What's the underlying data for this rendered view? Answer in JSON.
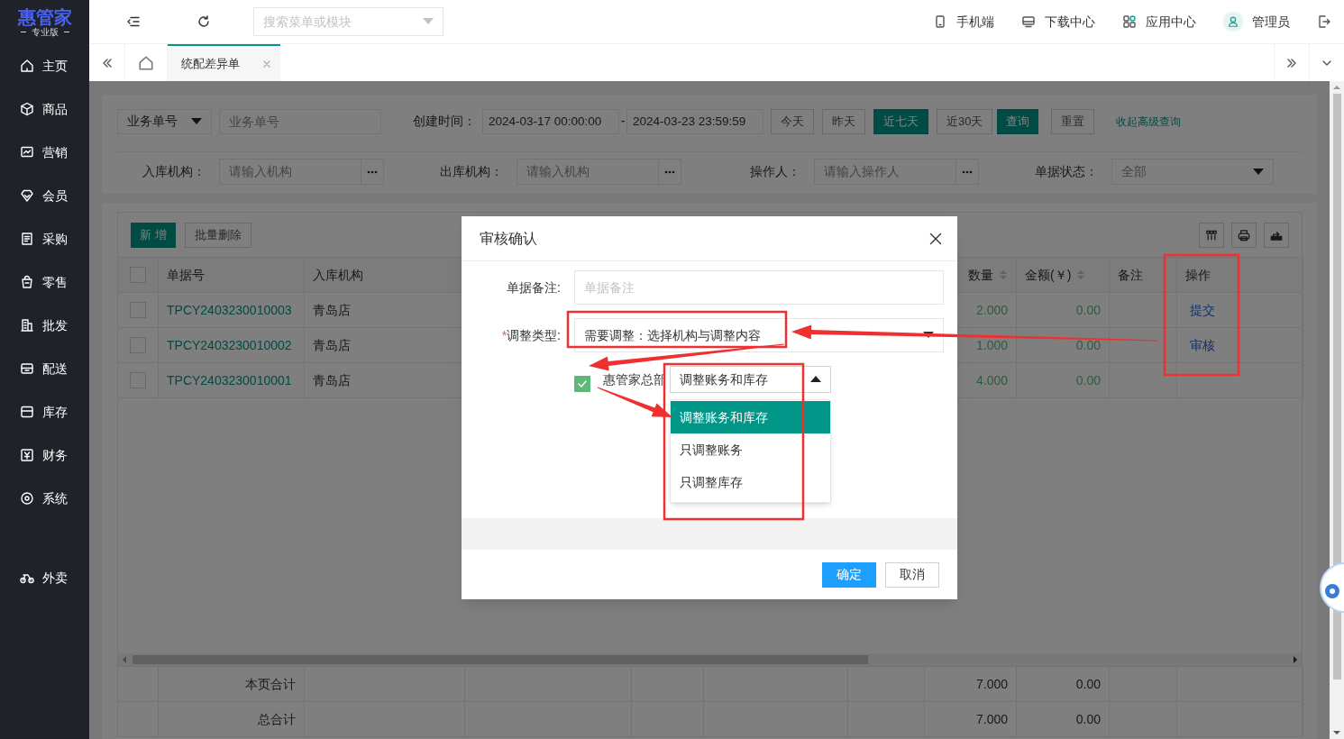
{
  "sidebar": {
    "logo": "惠管家",
    "edition": "专业版",
    "items": [
      {
        "label": "主页",
        "kind": "home"
      },
      {
        "label": "商品",
        "kind": "box"
      },
      {
        "label": "营销",
        "kind": "chart"
      },
      {
        "label": "会员",
        "kind": "gem"
      },
      {
        "label": "采购",
        "kind": "list"
      },
      {
        "label": "零售",
        "kind": "bag"
      },
      {
        "label": "批发",
        "kind": "building"
      },
      {
        "label": "配送",
        "kind": "crate"
      },
      {
        "label": "库存",
        "kind": "tray"
      },
      {
        "label": "财务",
        "kind": "money"
      },
      {
        "label": "系统",
        "kind": "target"
      }
    ],
    "bottom_items": [
      {
        "label": "外卖",
        "kind": "bike"
      }
    ]
  },
  "top_bar": {
    "search": {
      "placeholder": "搜索菜单或模块"
    },
    "links": [
      {
        "label": "手机端",
        "kind": "phone"
      },
      {
        "label": "下载中心",
        "kind": "monitor"
      },
      {
        "label": "应用中心",
        "kind": "apps"
      },
      {
        "label": "管理员",
        "kind": "user"
      }
    ]
  },
  "tabs": [
    {
      "label": "统配差异单",
      "selected": true
    }
  ],
  "filters": {
    "type_select": "业务单号",
    "number_placeholder": "业务单号",
    "created_label": "创建时间：",
    "date_from": "2024-03-17 00:00:00",
    "date_sep": "-",
    "date_to": "2024-03-23 23:59:59",
    "ranges": [
      {
        "label": "今天",
        "selected": false
      },
      {
        "label": "昨天",
        "selected": false
      },
      {
        "label": "近七天",
        "selected": true
      },
      {
        "label": "近30天",
        "selected": false
      }
    ],
    "query": "查询",
    "reset": "重置",
    "collapse": "收起高级查询",
    "fields": [
      {
        "label": "入库机构：",
        "placeholder": "请输入机构"
      },
      {
        "label": "出库机构：",
        "placeholder": "请输入机构"
      },
      {
        "label": "操作人：",
        "placeholder": "请输入操作人"
      }
    ],
    "status": {
      "label": "单据状态：",
      "placeholder": "全部"
    }
  },
  "toolbar": {
    "buttons": [
      {
        "label": "新 增",
        "kind": "primary"
      },
      {
        "label": "批量删除",
        "kind": "default"
      }
    ]
  },
  "table": {
    "header_checked": false,
    "columns": [
      {
        "label": "单据号",
        "sortable": false
      },
      {
        "label": "入库机构",
        "sortable": false
      },
      {
        "label": "数量",
        "sortable": true
      },
      {
        "label": "金额(￥)",
        "sortable": true
      },
      {
        "label": "备注",
        "sortable": false
      },
      {
        "label": "操作",
        "sortable": false
      }
    ],
    "rows": [
      {
        "checked": false,
        "number": "TPCY2403230010003",
        "store": "青岛店",
        "quantity": "2.000",
        "amount": "0.00",
        "action": "提交"
      },
      {
        "checked": false,
        "number": "TPCY2403230010002",
        "store": "青岛店",
        "quantity": "1.000",
        "amount": "0.00",
        "action": "审核"
      },
      {
        "checked": false,
        "number": "TPCY2403230010001",
        "store": "青岛店",
        "quantity": "4.000",
        "amount": "0.00"
      }
    ],
    "summary": [
      {
        "label": "本页合计",
        "quantity": "7.000",
        "amount": "0.00"
      },
      {
        "label": "总合计",
        "quantity": "7.000",
        "amount": "0.00"
      }
    ]
  },
  "dialog": {
    "title": "审核确认",
    "remark": {
      "label": "单据备注:",
      "placeholder": "单据备注"
    },
    "adjust_type": {
      "required_mark": "*",
      "label": "调整类型:",
      "value": "需要调整：选择机构与调整内容"
    },
    "org": {
      "checked": true,
      "label": "惠管家总部",
      "value": "调整账务和库存",
      "expanded": true,
      "options": [
        {
          "label": "调整账务和库存",
          "selected": true
        },
        {
          "label": "只调整账务",
          "selected": false
        },
        {
          "label": "只调整库存",
          "selected": false
        }
      ]
    },
    "buttons": [
      {
        "label": "确定",
        "kind": "primary"
      },
      {
        "label": "取消",
        "kind": "default"
      }
    ]
  }
}
